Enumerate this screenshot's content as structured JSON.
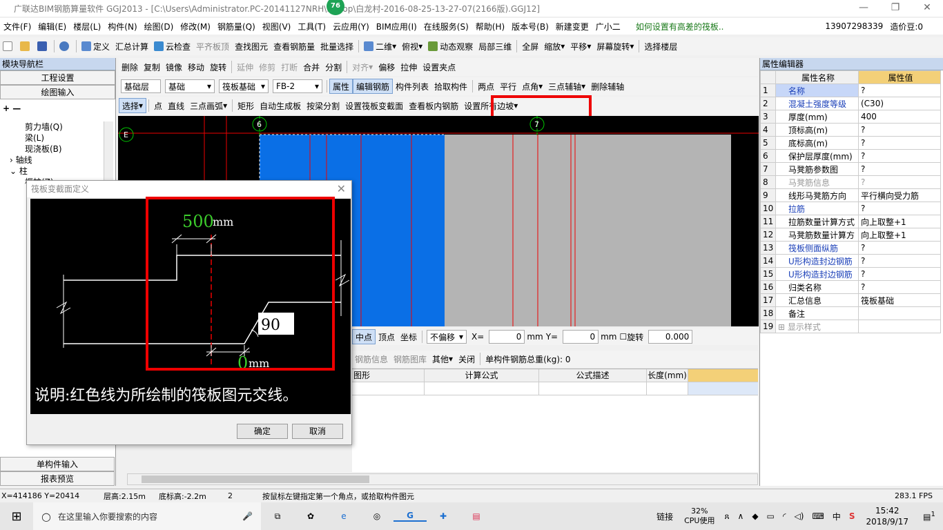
{
  "window": {
    "title": "广联达BIM钢筋算量软件 GGJ2013 - [C:\\Users\\Administrator.PC-20141127NRH\\...ktop\\白龙村-2016-08-25-13-27-07(2166版).GGJ12]",
    "badge": "76"
  },
  "menu": {
    "items": [
      "文件(F)",
      "编辑(E)",
      "楼层(L)",
      "构件(N)",
      "绘图(D)",
      "修改(M)",
      "钢筋量(Q)",
      "视图(V)",
      "工具(T)",
      "云应用(Y)",
      "BIM应用(I)",
      "在线服务(S)",
      "帮助(H)",
      "版本号(B)",
      "新建变更",
      "广小二"
    ],
    "hint": "如何设置有高差的筏板..",
    "phone": "13907298339",
    "price": "造价豆:0"
  },
  "toolbar1": [
    "定义",
    "汇总计算",
    "云检查",
    "平齐板顶",
    "查找图元",
    "查看钢筋量",
    "批量选择",
    "二维",
    "俯视",
    "动态观察",
    "局部三维",
    "全屏",
    "缩放",
    "平移",
    "屏幕旋转",
    "选择楼层"
  ],
  "toolbar2": [
    "删除",
    "复制",
    "镜像",
    "移动",
    "旋转",
    "延伸",
    "修剪",
    "打断",
    "合并",
    "分割",
    "对齐",
    "偏移",
    "拉伸",
    "设置夹点"
  ],
  "toolbar3": {
    "layer": "基础层",
    "category": "基础",
    "type": "筏板基础",
    "element": "FB-2",
    "items": [
      "属性",
      "编辑钢筋",
      "构件列表",
      "拾取构件",
      "两点",
      "平行",
      "点角",
      "三点辅轴",
      "删除辅轴"
    ]
  },
  "toolbar4": [
    "选择",
    "点",
    "直线",
    "三点画弧",
    "矩形",
    "自动生成板",
    "按梁分割",
    "设置筏板变截面",
    "查看板内钢筋",
    "设置所有边坡"
  ],
  "leftpanel": {
    "title": "模块导航栏",
    "btn1": "工程设置",
    "btn2": "绘图输入",
    "tree": [
      "剪力墙(Q)",
      "梁(L)",
      "现浇板(B)",
      "轴线",
      "柱",
      "框柱(Z)"
    ],
    "btn3": "单构件输入",
    "btn4": "报表预览"
  },
  "canvas": {
    "axis_labels": [
      "E",
      "6",
      "7"
    ]
  },
  "snapbar": {
    "items": [
      "中点",
      "顶点",
      "坐标"
    ],
    "offset": "不偏移",
    "x_label": "X=",
    "x_val": "0",
    "y_label": "Y=",
    "y_val": "0",
    "unit": "mm",
    "rotate": "旋转",
    "rotate_val": "0.000"
  },
  "rebar_toolbar": [
    "钢筋信息",
    "钢筋图库",
    "其他",
    "关闭"
  ],
  "rebar_total": "单构件钢筋总重(kg): 0",
  "rebar_table_headers": [
    "图形",
    "计算公式",
    "公式描述",
    "长度(mm)"
  ],
  "dialog": {
    "title": "筏板变截面定义",
    "dim_top": "500",
    "dim_top_unit": "mm",
    "angle": "90",
    "dim_bottom": "0",
    "dim_bottom_unit": "mm",
    "note": "说明:红色线为所绘制的筏板图元交线。",
    "ok": "确定",
    "cancel": "取消"
  },
  "properties": {
    "title": "属性编辑器",
    "col_name": "属性名称",
    "col_value": "属性值",
    "rows": [
      {
        "n": "1",
        "name": "名称",
        "value": "?",
        "style": "blue"
      },
      {
        "n": "2",
        "name": "混凝土强度等级",
        "value": "(C30)",
        "style": "blue"
      },
      {
        "n": "3",
        "name": "厚度(mm)",
        "value": "400",
        "style": ""
      },
      {
        "n": "4",
        "name": "顶标高(m)",
        "value": "?",
        "style": ""
      },
      {
        "n": "5",
        "name": "底标高(m)",
        "value": "?",
        "style": ""
      },
      {
        "n": "6",
        "name": "保护层厚度(mm)",
        "value": "?",
        "style": ""
      },
      {
        "n": "7",
        "name": "马凳筋参数图",
        "value": "?",
        "style": ""
      },
      {
        "n": "8",
        "name": "马凳筋信息",
        "value": "?",
        "style": "gray"
      },
      {
        "n": "9",
        "name": "线形马凳筋方向",
        "value": "平行横向受力筋",
        "style": ""
      },
      {
        "n": "10",
        "name": "拉筋",
        "value": "?",
        "style": "blue"
      },
      {
        "n": "11",
        "name": "拉筋数量计算方式",
        "value": "向上取整+1",
        "style": ""
      },
      {
        "n": "12",
        "name": "马凳筋数量计算方",
        "value": "向上取整+1",
        "style": ""
      },
      {
        "n": "13",
        "name": "筏板侧面纵筋",
        "value": "?",
        "style": "blue"
      },
      {
        "n": "14",
        "name": "U形构造封边钢筋",
        "value": "?",
        "style": "blue"
      },
      {
        "n": "15",
        "name": "U形构造封边钢筋",
        "value": "?",
        "style": "blue"
      },
      {
        "n": "16",
        "name": "归类名称",
        "value": "?",
        "style": ""
      },
      {
        "n": "17",
        "name": "汇总信息",
        "value": "筏板基础",
        "style": ""
      },
      {
        "n": "18",
        "name": "备注",
        "value": "",
        "style": ""
      },
      {
        "n": "19",
        "name": "显示样式",
        "value": "",
        "style": "gray"
      }
    ]
  },
  "status": {
    "coords": "X=414186 Y=20414",
    "floor_height": "层高:2.15m",
    "base_height": "底标高:-2.2m",
    "num": "2",
    "hint": "按鼠标左键指定第一个角点，或拾取构件图元",
    "fps": "283.1 FPS"
  },
  "taskbar": {
    "search": "在这里输入你要搜索的内容",
    "link": "链接",
    "cpu": "32%",
    "cpu_label": "CPU使用",
    "ime": "中",
    "time": "15:42",
    "date": "2018/9/17",
    "notif": "1"
  },
  "colors": {
    "highlight": "#e00000",
    "slab_blue": "#0a6fe6",
    "slab_gray": "#b4b4b4",
    "dim_green": "#3ccc2c"
  }
}
